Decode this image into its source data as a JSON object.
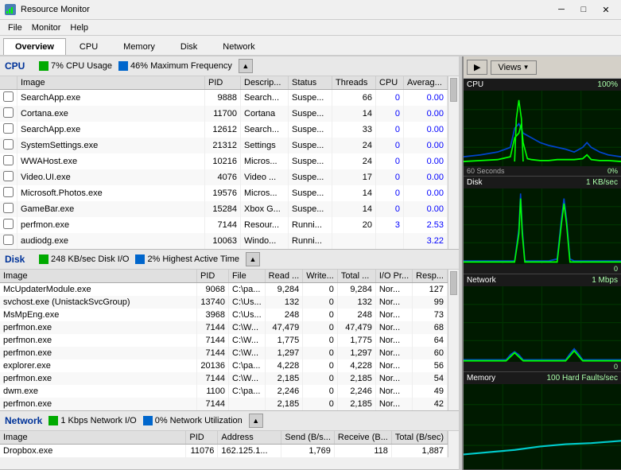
{
  "titlebar": {
    "title": "Resource Monitor",
    "icon": "RM",
    "min": "─",
    "max": "□",
    "close": "✕"
  },
  "menubar": {
    "items": [
      "File",
      "Monitor",
      "Help"
    ]
  },
  "tabs": {
    "items": [
      "Overview",
      "CPU",
      "Memory",
      "Disk",
      "Network"
    ],
    "active": "Overview"
  },
  "cpu": {
    "title": "CPU",
    "stat1": "7% CPU Usage",
    "stat2": "46% Maximum Frequency",
    "columns": [
      "Image",
      "PID",
      "Descrip...",
      "Status",
      "Threads",
      "CPU",
      "Averag..."
    ],
    "rows": [
      [
        "",
        "SearchApp.exe",
        "9888",
        "Search...",
        "Suspe...",
        "66",
        "0",
        "0.00"
      ],
      [
        "",
        "Cortana.exe",
        "11700",
        "Cortana",
        "Suspe...",
        "14",
        "0",
        "0.00"
      ],
      [
        "",
        "SearchApp.exe",
        "12612",
        "Search...",
        "Suspe...",
        "33",
        "0",
        "0.00"
      ],
      [
        "",
        "SystemSettings.exe",
        "21312",
        "Settings",
        "Suspe...",
        "24",
        "0",
        "0.00"
      ],
      [
        "",
        "WWAHost.exe",
        "10216",
        "Micros...",
        "Suspe...",
        "24",
        "0",
        "0.00"
      ],
      [
        "",
        "Video.UI.exe",
        "4076",
        "Video ...",
        "Suspe...",
        "17",
        "0",
        "0.00"
      ],
      [
        "",
        "Microsoft.Photos.exe",
        "19576",
        "Micros...",
        "Suspe...",
        "14",
        "0",
        "0.00"
      ],
      [
        "",
        "GameBar.exe",
        "15284",
        "Xbox G...",
        "Suspe...",
        "14",
        "0",
        "0.00"
      ],
      [
        "",
        "perfmon.exe",
        "7144",
        "Resour...",
        "Runni...",
        "20",
        "3",
        "2.53"
      ],
      [
        "",
        "audiodg.exe",
        "10063",
        "Windo...",
        "Runni...",
        "",
        "",
        "3.22"
      ]
    ]
  },
  "disk": {
    "title": "Disk",
    "stat1": "248 KB/sec Disk I/O",
    "stat2": "2% Highest Active Time",
    "columns": [
      "Image",
      "PID",
      "File",
      "Read ...",
      "Write...",
      "Total ...",
      "I/O Pr...",
      "Resp..."
    ],
    "rows": [
      [
        "McUpdaterModule.exe",
        "9068",
        "C:\\pa...",
        "9,284",
        "0",
        "9,284",
        "Nor...",
        "127"
      ],
      [
        "svchost.exe (UnistackSvcGroup)",
        "13740",
        "C:\\Us...",
        "132",
        "0",
        "132",
        "Nor...",
        "99"
      ],
      [
        "MsMpEng.exe",
        "3968",
        "C:\\Us...",
        "248",
        "0",
        "248",
        "Nor...",
        "73"
      ],
      [
        "perfmon.exe",
        "7144",
        "C:\\W...",
        "47,479",
        "0",
        "47,479",
        "Nor...",
        "68"
      ],
      [
        "perfmon.exe",
        "7144",
        "C:\\W...",
        "1,775",
        "0",
        "1,775",
        "Nor...",
        "64"
      ],
      [
        "perfmon.exe",
        "7144",
        "C:\\W...",
        "1,297",
        "0",
        "1,297",
        "Nor...",
        "60"
      ],
      [
        "explorer.exe",
        "20136",
        "C:\\pa...",
        "4,228",
        "0",
        "4,228",
        "Nor...",
        "56"
      ],
      [
        "perfmon.exe",
        "7144",
        "C:\\W...",
        "2,185",
        "0",
        "2,185",
        "Nor...",
        "54"
      ],
      [
        "dwm.exe",
        "1100",
        "C:\\pa...",
        "2,246",
        "0",
        "2,246",
        "Nor...",
        "49"
      ],
      [
        "perfmon.exe",
        "7144",
        "",
        "2,185",
        "0",
        "2,185",
        "Nor...",
        "42"
      ]
    ]
  },
  "network": {
    "title": "Network",
    "stat1": "1 Kbps Network I/O",
    "stat2": "0% Network Utilization",
    "columns": [
      "Image",
      "PID",
      "Address",
      "Send (B/s...",
      "Receive (B...",
      "Total (B/sec)"
    ],
    "rows": [
      [
        "Dropbox.exe",
        "11076",
        "162.125.1...",
        "1,769",
        "118",
        "1,887"
      ]
    ]
  },
  "graphs": {
    "forward_btn": "▶",
    "views_label": "Views",
    "items": [
      {
        "label": "CPU",
        "pct": "100%",
        "sub_right": "0%",
        "sub_label": "60 Seconds",
        "color_main": "#00ff00",
        "color_sec": "#0055ff"
      },
      {
        "label": "Disk",
        "stat": "1 KB/sec",
        "sub_right": "0",
        "color_main": "#00ff00",
        "color_sec": "#0055ff"
      },
      {
        "label": "Network",
        "stat": "1 Mbps",
        "sub_right": "0",
        "color_main": "#00ff00",
        "color_sec": "#0055ff"
      },
      {
        "label": "Memory",
        "stat": "100 Hard Faults/sec",
        "sub_right": "",
        "color_main": "#00ffff",
        "color_sec": "#0055ff"
      }
    ]
  }
}
